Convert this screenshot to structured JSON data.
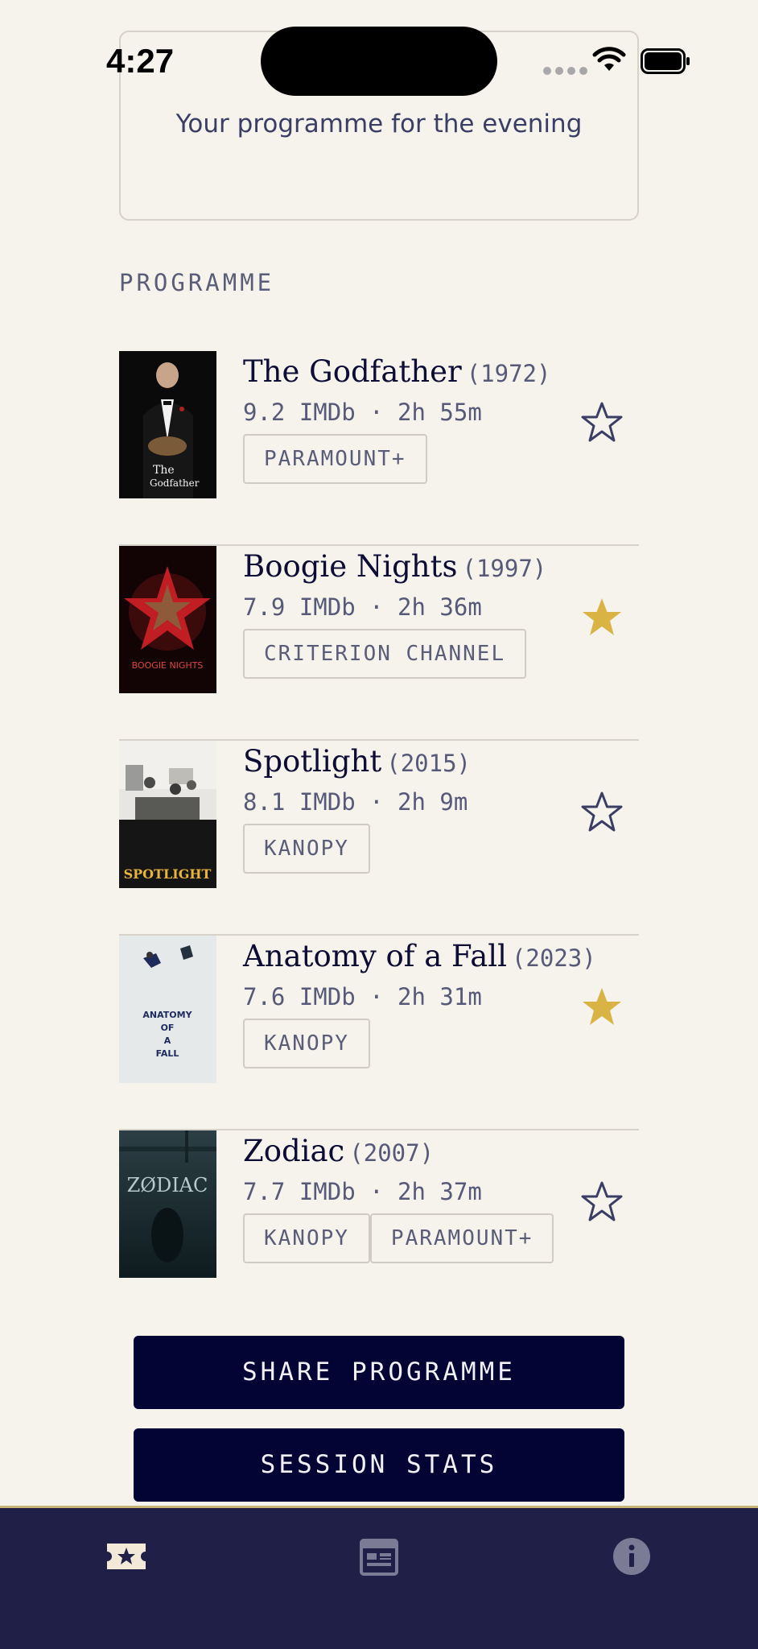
{
  "status_bar": {
    "time": "4:27"
  },
  "header": {
    "subtitle": "Your programme for the evening"
  },
  "section": {
    "label": "PROGRAMME"
  },
  "films": [
    {
      "title": "The Godfather",
      "year": "(1972)",
      "meta": "9.2 IMDb · 2h 55m",
      "tags": [
        "PARAMOUNT+"
      ],
      "starred": false
    },
    {
      "title": "Boogie Nights",
      "year": "(1997)",
      "meta": "7.9 IMDb · 2h 36m",
      "tags": [
        "CRITERION CHANNEL"
      ],
      "starred": true
    },
    {
      "title": "Spotlight",
      "year": "(2015)",
      "meta": "8.1 IMDb · 2h 9m",
      "tags": [
        "KANOPY"
      ],
      "starred": false
    },
    {
      "title": "Anatomy of a Fall",
      "year": "(2023)",
      "meta": "7.6 IMDb · 2h 31m",
      "tags": [
        "KANOPY"
      ],
      "starred": true
    },
    {
      "title": "Zodiac",
      "year": "(2007)",
      "meta": "7.7 IMDb · 2h 37m",
      "tags": [
        "KANOPY",
        "PARAMOUNT+"
      ],
      "starred": false
    }
  ],
  "posters": {
    "godfather": {
      "line1": "The",
      "line2": "Godfather"
    },
    "boogie": {
      "text": "BOOGIE NIGHTS"
    },
    "spotlight": {
      "text": "SPOTLIGHT"
    },
    "anatomy": {
      "line1": "ANATOMY",
      "line2": "OF",
      "line3": "A",
      "line4": "FALL"
    },
    "zodiac": {
      "text": "ZØDIAC"
    }
  },
  "buttons": {
    "share": "SHARE PROGRAMME",
    "stats": "SESSION STATS"
  },
  "colors": {
    "star_filled": "#d9b444",
    "star_outline": "#3b3e64",
    "button_bg": "#030334",
    "tabbar_bg": "#1f1f48"
  },
  "icons": {
    "tab1": "ticket-star-icon",
    "tab2": "calendar-icon",
    "tab3": "info-icon"
  }
}
